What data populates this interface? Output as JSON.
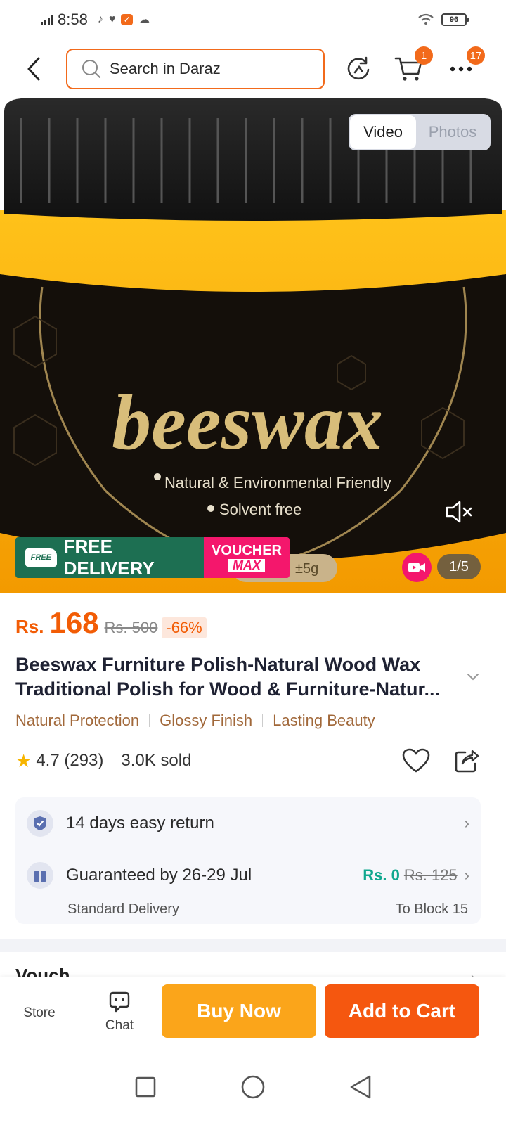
{
  "status_bar": {
    "time": "8:58",
    "battery": "96"
  },
  "header": {
    "search_placeholder": "Search in Daraz",
    "cart_count": "1",
    "more_count": "17"
  },
  "media": {
    "tabs": [
      "Video",
      "Photos"
    ],
    "active_tab": "Video",
    "counter": "1/5",
    "image_text": {
      "brand": "beeswax",
      "line1": "Natural & Environmental Friendly",
      "line2": "Solvent free",
      "weight": "±5g"
    },
    "banner": {
      "free_badge": "FREE",
      "free_delivery": "FREE DELIVERY",
      "voucher": "VOUCHER",
      "voucher_max": "MAX"
    }
  },
  "price": {
    "currency": "Rs.",
    "current": "168",
    "original": "Rs. 500",
    "discount": "-66%"
  },
  "product": {
    "title": "Beeswax Furniture Polish-Natural Wood Wax Traditional Polish for Wood & Furniture-Natur...",
    "tags": [
      "Natural Protection",
      "Glossy Finish",
      "Lasting Beauty"
    ],
    "rating": "4.7 (293)",
    "sold": "3.0K sold"
  },
  "service": {
    "return_text": "14 days easy return",
    "delivery_text": "Guaranteed by 26-29 Jul",
    "delivery_price": "Rs. 0",
    "delivery_old_price": "Rs. 125",
    "delivery_type": "Standard Delivery",
    "delivery_to": "To Block 15"
  },
  "next_section_peek": "Vouch",
  "bottom_bar": {
    "store": "Store",
    "chat": "Chat",
    "buy_now": "Buy Now",
    "add_to_cart": "Add to Cart"
  },
  "colors": {
    "brand_orange": "#f26a1b",
    "buy_now": "#fba51a",
    "add_to_cart": "#f5570f",
    "free_delivery": "#1d6f52",
    "voucher": "#f4176c",
    "teal_price": "#11a88f"
  }
}
